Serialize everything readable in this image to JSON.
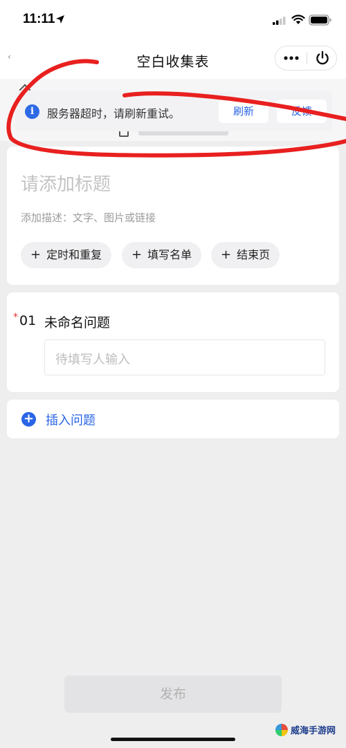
{
  "status_bar": {
    "time": "11:11"
  },
  "nav": {
    "title": "空白收集表"
  },
  "toast": {
    "message": "服务器超时，请刷新重试。",
    "refresh_label": "刷新",
    "feedback_label": "反馈"
  },
  "form": {
    "title_placeholder": "请添加标题",
    "description_placeholder": "添加描述：文字、图片或链接",
    "chips": [
      "定时和重复",
      "填写名单",
      "结束页"
    ],
    "chip_plus": "+"
  },
  "question": {
    "required_mark": "*",
    "number": "01",
    "title": "未命名问题",
    "input_placeholder": "待填写人输入"
  },
  "insert": {
    "label": "插入问题",
    "icon_glyph": "+"
  },
  "publish": {
    "label": "发布"
  },
  "watermark": {
    "text": "威海手游网"
  },
  "colors": {
    "accent": "#2a64e6",
    "annotation_red": "#e8201f",
    "required": "#e0312b"
  }
}
